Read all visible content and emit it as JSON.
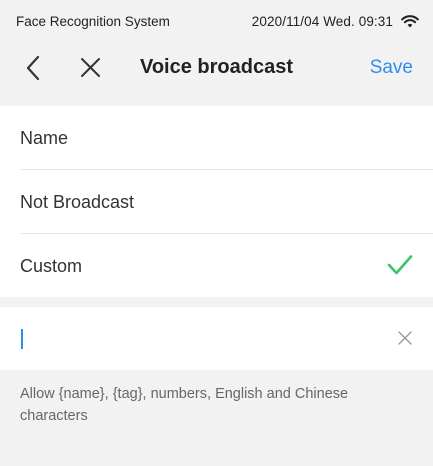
{
  "status_bar": {
    "app_name": "Face Recognition System",
    "clock": "2020/11/04  Wed.  09:31",
    "wifi_icon": "wifi-icon"
  },
  "nav": {
    "back_icon": "chevron-left-icon",
    "close_icon": "close-icon",
    "title": "Voice broadcast",
    "save_label": "Save"
  },
  "options": [
    {
      "label": "Name",
      "selected": false
    },
    {
      "label": "Not Broadcast",
      "selected": false
    },
    {
      "label": "Custom",
      "selected": true
    }
  ],
  "custom_input": {
    "value": "",
    "clear_icon": "close-icon"
  },
  "hint": "Allow {name}, {tag}, numbers, English and Chinese characters",
  "colors": {
    "accent": "#2f8cf0",
    "check": "#3cc36b",
    "background": "#f2f2f2",
    "card": "#ffffff"
  }
}
